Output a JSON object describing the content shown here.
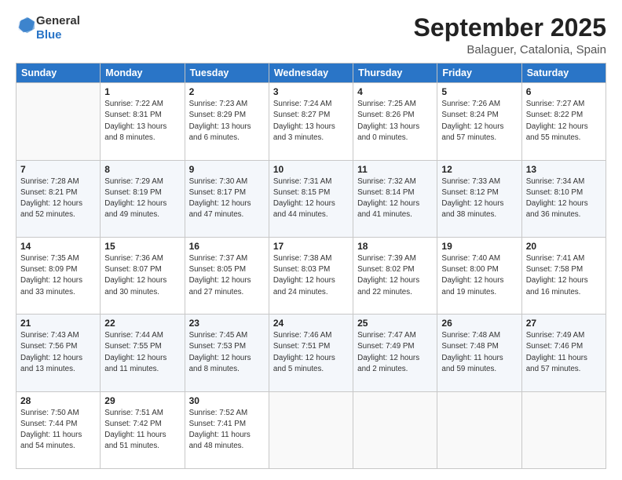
{
  "logo": {
    "general": "General",
    "blue": "Blue"
  },
  "title": {
    "month": "September 2025",
    "location": "Balaguer, Catalonia, Spain"
  },
  "weekdays": [
    "Sunday",
    "Monday",
    "Tuesday",
    "Wednesday",
    "Thursday",
    "Friday",
    "Saturday"
  ],
  "weeks": [
    [
      {
        "day": "",
        "detail": ""
      },
      {
        "day": "1",
        "detail": "Sunrise: 7:22 AM\nSunset: 8:31 PM\nDaylight: 13 hours\nand 8 minutes."
      },
      {
        "day": "2",
        "detail": "Sunrise: 7:23 AM\nSunset: 8:29 PM\nDaylight: 13 hours\nand 6 minutes."
      },
      {
        "day": "3",
        "detail": "Sunrise: 7:24 AM\nSunset: 8:27 PM\nDaylight: 13 hours\nand 3 minutes."
      },
      {
        "day": "4",
        "detail": "Sunrise: 7:25 AM\nSunset: 8:26 PM\nDaylight: 13 hours\nand 0 minutes."
      },
      {
        "day": "5",
        "detail": "Sunrise: 7:26 AM\nSunset: 8:24 PM\nDaylight: 12 hours\nand 57 minutes."
      },
      {
        "day": "6",
        "detail": "Sunrise: 7:27 AM\nSunset: 8:22 PM\nDaylight: 12 hours\nand 55 minutes."
      }
    ],
    [
      {
        "day": "7",
        "detail": "Sunrise: 7:28 AM\nSunset: 8:21 PM\nDaylight: 12 hours\nand 52 minutes."
      },
      {
        "day": "8",
        "detail": "Sunrise: 7:29 AM\nSunset: 8:19 PM\nDaylight: 12 hours\nand 49 minutes."
      },
      {
        "day": "9",
        "detail": "Sunrise: 7:30 AM\nSunset: 8:17 PM\nDaylight: 12 hours\nand 47 minutes."
      },
      {
        "day": "10",
        "detail": "Sunrise: 7:31 AM\nSunset: 8:15 PM\nDaylight: 12 hours\nand 44 minutes."
      },
      {
        "day": "11",
        "detail": "Sunrise: 7:32 AM\nSunset: 8:14 PM\nDaylight: 12 hours\nand 41 minutes."
      },
      {
        "day": "12",
        "detail": "Sunrise: 7:33 AM\nSunset: 8:12 PM\nDaylight: 12 hours\nand 38 minutes."
      },
      {
        "day": "13",
        "detail": "Sunrise: 7:34 AM\nSunset: 8:10 PM\nDaylight: 12 hours\nand 36 minutes."
      }
    ],
    [
      {
        "day": "14",
        "detail": "Sunrise: 7:35 AM\nSunset: 8:09 PM\nDaylight: 12 hours\nand 33 minutes."
      },
      {
        "day": "15",
        "detail": "Sunrise: 7:36 AM\nSunset: 8:07 PM\nDaylight: 12 hours\nand 30 minutes."
      },
      {
        "day": "16",
        "detail": "Sunrise: 7:37 AM\nSunset: 8:05 PM\nDaylight: 12 hours\nand 27 minutes."
      },
      {
        "day": "17",
        "detail": "Sunrise: 7:38 AM\nSunset: 8:03 PM\nDaylight: 12 hours\nand 24 minutes."
      },
      {
        "day": "18",
        "detail": "Sunrise: 7:39 AM\nSunset: 8:02 PM\nDaylight: 12 hours\nand 22 minutes."
      },
      {
        "day": "19",
        "detail": "Sunrise: 7:40 AM\nSunset: 8:00 PM\nDaylight: 12 hours\nand 19 minutes."
      },
      {
        "day": "20",
        "detail": "Sunrise: 7:41 AM\nSunset: 7:58 PM\nDaylight: 12 hours\nand 16 minutes."
      }
    ],
    [
      {
        "day": "21",
        "detail": "Sunrise: 7:43 AM\nSunset: 7:56 PM\nDaylight: 12 hours\nand 13 minutes."
      },
      {
        "day": "22",
        "detail": "Sunrise: 7:44 AM\nSunset: 7:55 PM\nDaylight: 12 hours\nand 11 minutes."
      },
      {
        "day": "23",
        "detail": "Sunrise: 7:45 AM\nSunset: 7:53 PM\nDaylight: 12 hours\nand 8 minutes."
      },
      {
        "day": "24",
        "detail": "Sunrise: 7:46 AM\nSunset: 7:51 PM\nDaylight: 12 hours\nand 5 minutes."
      },
      {
        "day": "25",
        "detail": "Sunrise: 7:47 AM\nSunset: 7:49 PM\nDaylight: 12 hours\nand 2 minutes."
      },
      {
        "day": "26",
        "detail": "Sunrise: 7:48 AM\nSunset: 7:48 PM\nDaylight: 11 hours\nand 59 minutes."
      },
      {
        "day": "27",
        "detail": "Sunrise: 7:49 AM\nSunset: 7:46 PM\nDaylight: 11 hours\nand 57 minutes."
      }
    ],
    [
      {
        "day": "28",
        "detail": "Sunrise: 7:50 AM\nSunset: 7:44 PM\nDaylight: 11 hours\nand 54 minutes."
      },
      {
        "day": "29",
        "detail": "Sunrise: 7:51 AM\nSunset: 7:42 PM\nDaylight: 11 hours\nand 51 minutes."
      },
      {
        "day": "30",
        "detail": "Sunrise: 7:52 AM\nSunset: 7:41 PM\nDaylight: 11 hours\nand 48 minutes."
      },
      {
        "day": "",
        "detail": ""
      },
      {
        "day": "",
        "detail": ""
      },
      {
        "day": "",
        "detail": ""
      },
      {
        "day": "",
        "detail": ""
      }
    ]
  ]
}
